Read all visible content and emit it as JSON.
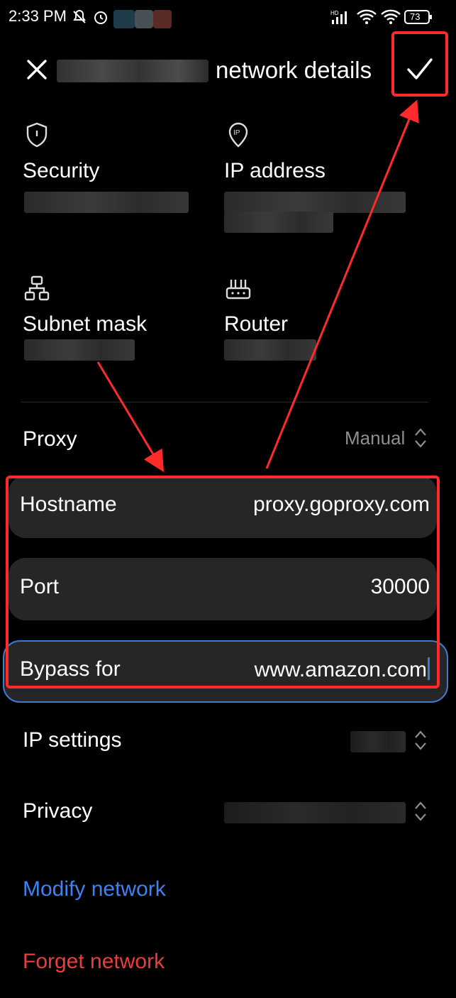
{
  "status_bar": {
    "time": "2:33 PM",
    "battery": "73",
    "icons": [
      "mute-icon",
      "alarm-icon",
      "hd-signal-icon",
      "wifi-icon",
      "wifi-icon",
      "battery-icon"
    ]
  },
  "header": {
    "title": "network details",
    "close_icon": "close-icon",
    "confirm_icon": "checkmark-icon"
  },
  "details": {
    "security": {
      "label": "Security",
      "icon": "shield-icon"
    },
    "ip_address": {
      "label": "IP address",
      "icon": "ip-pin-icon"
    },
    "subnet_mask": {
      "label": "Subnet mask",
      "icon": "network-tree-icon"
    },
    "router": {
      "label": "Router",
      "icon": "router-icon"
    }
  },
  "proxy": {
    "label": "Proxy",
    "value": "Manual",
    "hostname": {
      "label": "Hostname",
      "value": "proxy.goproxy.com"
    },
    "port": {
      "label": "Port",
      "value": "30000"
    },
    "bypass": {
      "label": "Bypass for",
      "value": "www.amazon.com"
    }
  },
  "settings": {
    "ip_settings": {
      "label": "IP settings"
    },
    "privacy": {
      "label": "Privacy"
    }
  },
  "actions": {
    "modify": "Modify network",
    "forget": "Forget network"
  },
  "colors": {
    "background": "#000000",
    "field_bg": "#262626",
    "link_blue": "#3b82f6",
    "danger_red": "#ef3b3b",
    "annotation_red": "#ff2a2a",
    "focus_blue": "#3a7bd5"
  }
}
